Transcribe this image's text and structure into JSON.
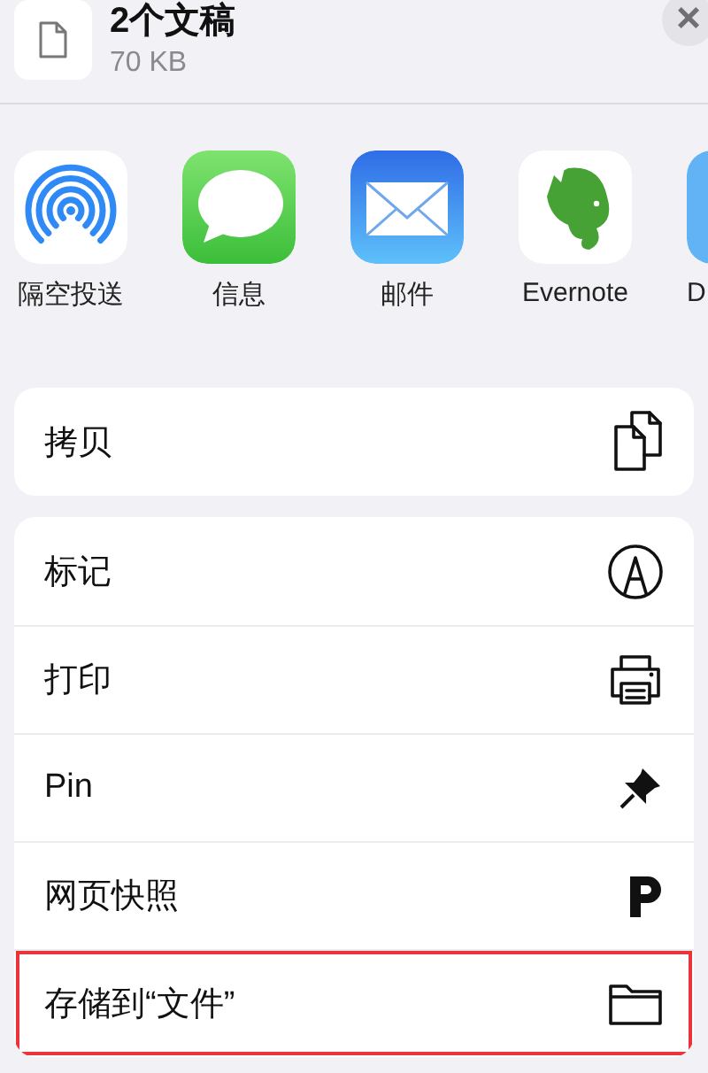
{
  "header": {
    "title": "2个文稿",
    "subtitle": "70 KB",
    "close": "×"
  },
  "apps": [
    {
      "label": "隔空投送",
      "kind": "airdrop"
    },
    {
      "label": "信息",
      "kind": "messages"
    },
    {
      "label": "邮件",
      "kind": "mail"
    },
    {
      "label": "Evernote",
      "kind": "elephant"
    },
    {
      "label": "D",
      "kind": "blue"
    }
  ],
  "groups": [
    [
      {
        "label": "拷贝",
        "kind": "copy",
        "highlighted": false
      }
    ],
    [
      {
        "label": "标记",
        "kind": "markup",
        "highlighted": false
      },
      {
        "label": "打印",
        "kind": "print",
        "highlighted": false
      },
      {
        "label": "Pin",
        "kind": "pin",
        "highlighted": false
      },
      {
        "label": "网页快照",
        "kind": "p",
        "highlighted": false
      },
      {
        "label": "存储到“文件”",
        "kind": "folder",
        "highlighted": true
      }
    ]
  ]
}
